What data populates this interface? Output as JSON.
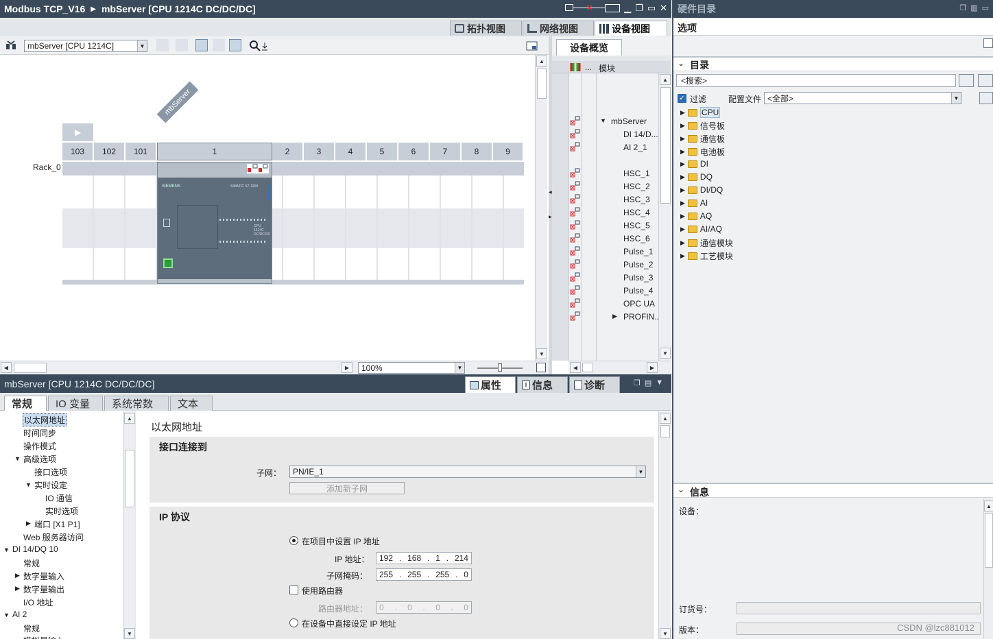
{
  "window": {
    "title_left": "Modbus TCP_V16",
    "title_right": "mbServer [CPU 1214C DC/DC/DC]"
  },
  "view_tabs": [
    {
      "label": "拓扑视图"
    },
    {
      "label": "网络视图"
    },
    {
      "label": "设备视图"
    }
  ],
  "toolbar": {
    "device_select": "mbServer [CPU 1214C]",
    "zoom": "100%"
  },
  "rack": {
    "device_label": "mbServer",
    "rack_label": "Rack_0",
    "slots": [
      "103",
      "102",
      "101",
      "1",
      "2",
      "3",
      "4",
      "5",
      "6",
      "7",
      "8",
      "9"
    ],
    "plc_brand": "SIEMENS",
    "plc_model": "SIMATIC S7-1200",
    "plc_cpu": "CPU 1214C DC/DC/DC"
  },
  "overview": {
    "tab": "设备概览",
    "col_dots": "...",
    "col_module": "模块",
    "rows": [
      "mbServer",
      "DI 14/D...",
      "AI 2_1",
      "",
      "HSC_1",
      "HSC_2",
      "HSC_3",
      "HSC_4",
      "HSC_5",
      "HSC_6",
      "Pulse_1",
      "Pulse_2",
      "Pulse_3",
      "Pulse_4",
      "OPC UA",
      "PROFIN..."
    ]
  },
  "props": {
    "title": "mbServer [CPU 1214C DC/DC/DC]",
    "tabs": [
      {
        "label": "属性"
      },
      {
        "label": "信息"
      },
      {
        "label": "诊断"
      }
    ],
    "general_tabs": [
      "常规",
      "IO 变量",
      "系统常数",
      "文本"
    ],
    "nav": {
      "ethernet": "以太网地址",
      "time_sync": "时间同步",
      "op_mode": "操作模式",
      "advanced": "高级选项",
      "iface_opts": "接口选项",
      "realtime": "实时设定",
      "io_comm": "IO 通信",
      "rt_opts": "实时选项",
      "port": "端口 [X1 P1]",
      "web": "Web 服务器访问",
      "di14": "DI 14/DQ 10",
      "di_general": "常规",
      "di_in": "数字量输入",
      "di_out": "数字量输出",
      "io_addr": "I/O 地址",
      "ai2": "AI 2",
      "ai_general": "常规",
      "ai_in": "模拟量输入"
    },
    "content": {
      "section": "以太网地址",
      "iface_group": "接口连接到",
      "subnet_label": "子网：",
      "subnet_value": "PN/IE_1",
      "add_subnet": "添加新子网",
      "ip_group": "IP 协议",
      "radio_project": "在项目中设置 IP 地址",
      "ip_label": "IP 地址：",
      "ip": [
        "192",
        "168",
        "1",
        "214"
      ],
      "mask_label": "子网掩码：",
      "mask": [
        "255",
        "255",
        "255",
        "0"
      ],
      "use_router": "使用路由器",
      "router_label": "路由器地址：",
      "router": [
        "0",
        "0",
        "0",
        "0"
      ],
      "radio_device": "在设备中直接设定 IP 地址"
    }
  },
  "catalog": {
    "title": "硬件目录",
    "options": "选项",
    "dir_title": "目录",
    "search_placeholder": "<搜索>",
    "filter_label": "过滤",
    "profile_label": "配置文件",
    "profile_value": "<全部>",
    "items": [
      "CPU",
      "信号板",
      "通信板",
      "电池板",
      "DI",
      "DQ",
      "DI/DQ",
      "AI",
      "AQ",
      "AI/AQ",
      "通信模块",
      "工艺模块"
    ],
    "info_title": "信息",
    "device_label": "设备：",
    "order_label": "订货号：",
    "version_label": "版本："
  },
  "watermark": "CSDN @lzc881012"
}
